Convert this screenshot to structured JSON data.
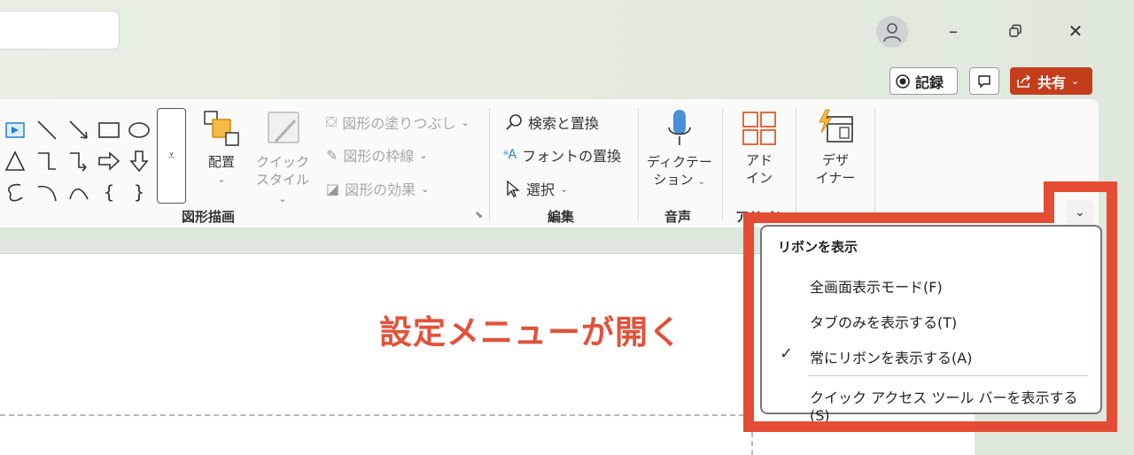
{
  "ribbon": {
    "shapes_group": {
      "label": "図形描画",
      "arrange_label": "配置",
      "quick_style_line1": "クイック",
      "quick_style_line2": "スタイル",
      "fill_label": "図形の塗りつぶし",
      "outline_label": "図形の枠線",
      "effects_label": "図形の効果"
    },
    "edit_group": {
      "label": "編集",
      "find_replace_label": "検索と置換",
      "font_replace_label": "フォントの置換",
      "select_label": "選択"
    },
    "voice_group": {
      "label": "音声",
      "dictate_line1": "ディクテー",
      "dictate_line2": "ション"
    },
    "addin_group": {
      "label": "アドイン",
      "addin_line1": "アド",
      "addin_line2": "イン"
    },
    "designer_line1": "デザ",
    "designer_line2": "イナー"
  },
  "topbar": {
    "record_label": "記録",
    "share_label": "共有"
  },
  "dropdown": {
    "title": "リボンを表示",
    "items": [
      {
        "label": "全画面表示モード(F)"
      },
      {
        "label": "タブのみを表示する(T)"
      },
      {
        "label": "常にリボンを表示する(A)",
        "checked": true
      },
      {
        "label": "クイック アクセス ツール バーを表示する (S)"
      }
    ]
  },
  "annotation": "設定メニューが開く",
  "colors": {
    "accent": "#e44c34",
    "share": "#c43e1c"
  }
}
